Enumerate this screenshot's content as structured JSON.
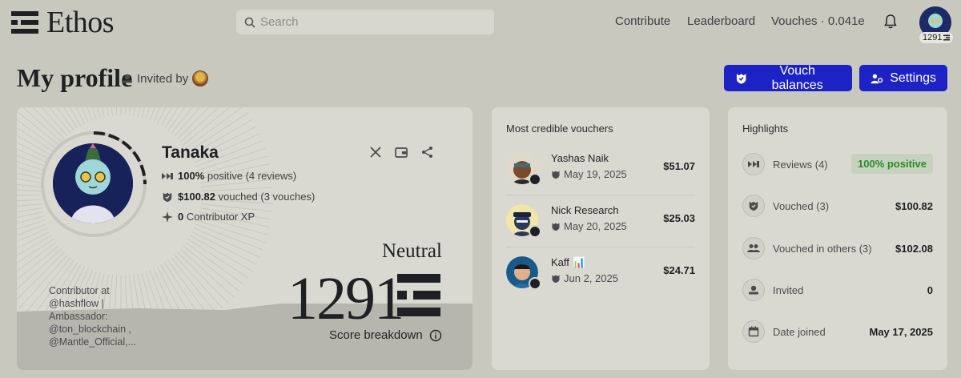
{
  "header": {
    "logo_text": "Ethos",
    "search_placeholder": "Search",
    "nav": {
      "contribute": "Contribute",
      "leaderboard": "Leaderboard",
      "vouches": "Vouches · 0.041e"
    },
    "user_score": "1291"
  },
  "title_row": {
    "title": "My profile",
    "invited_by": "Invited by",
    "vouch_balances": "Vouch balances",
    "settings": "Settings"
  },
  "profile": {
    "name": "Tanaka",
    "review_pct": "100%",
    "review_rest": "positive (4 reviews)",
    "vouched_amount": "$100.82",
    "vouched_rest": "vouched (3 vouches)",
    "xp_value": "0",
    "xp_rest": "Contributor XP",
    "bio": "Contributor at @hashflow | Ambassador: @ton_blockchain , @Mantle_Official,...",
    "level": "Neutral",
    "score": "1291",
    "breakdown": "Score breakdown"
  },
  "vouchers": {
    "title": "Most credible vouchers",
    "items": [
      {
        "name": "Yashas Naik",
        "date": "May 19, 2025",
        "amount": "$51.07"
      },
      {
        "name": "Nick Research",
        "date": "May 20, 2025",
        "amount": "$25.03"
      },
      {
        "name": "Kaff 📊",
        "date": "Jun 2, 2025",
        "amount": "$24.71"
      }
    ]
  },
  "highlights": {
    "title": "Highlights",
    "items": [
      {
        "label": "Reviews (4)",
        "value": "100% positive",
        "icon": "reviews-icon"
      },
      {
        "label": "Vouched (3)",
        "value": "$100.82",
        "icon": "vouch-icon"
      },
      {
        "label": "Vouched in others (3)",
        "value": "$102.08",
        "icon": "people-icon"
      },
      {
        "label": "Invited",
        "value": "0",
        "icon": "invite-icon"
      },
      {
        "label": "Date joined",
        "value": "May 17, 2025",
        "icon": "calendar-icon"
      }
    ]
  },
  "colors": {
    "accent": "#1d22c5",
    "background": "#c9c8bf",
    "card": "#dad9d1",
    "positive": "#2a8a2a"
  }
}
